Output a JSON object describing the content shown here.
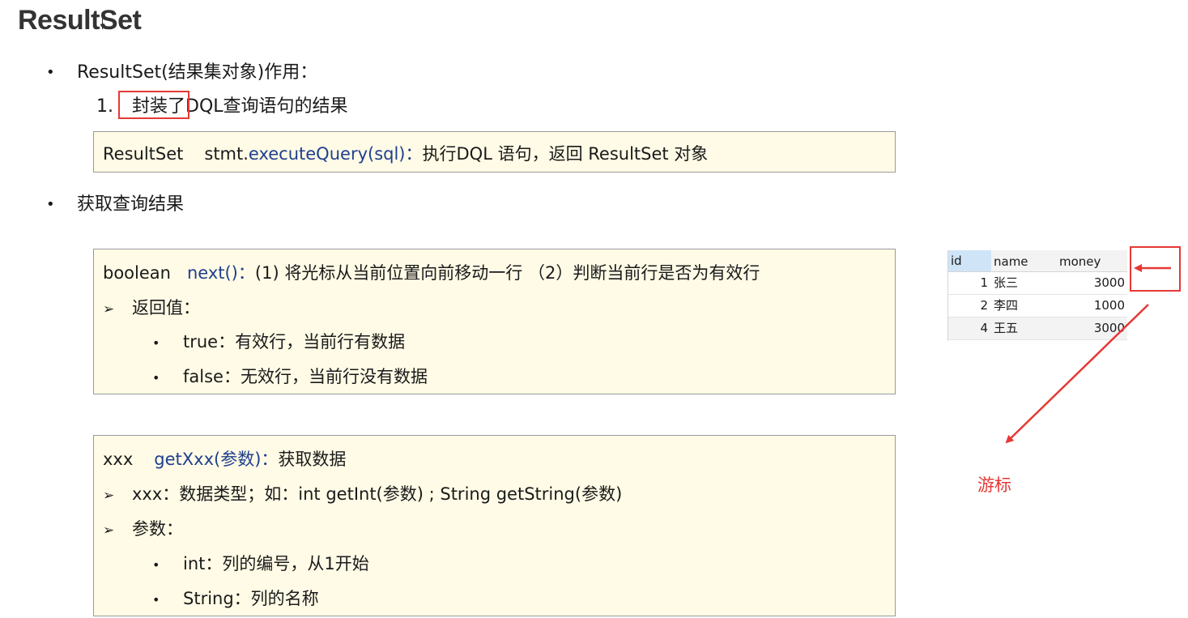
{
  "title": "ResultSet",
  "section1": {
    "bullet": "ResultSet(结果集对象)作用：",
    "numbered_prefix": "1.",
    "numbered_highlight": "封装了",
    "numbered_rest": "DQL查询语句的结果",
    "panel": {
      "type": "ResultSet",
      "obj": "stmt.",
      "method": "executeQuery(sql)：",
      "desc": "执行DQL 语句，返回 ResultSet 对象"
    }
  },
  "section2": {
    "bullet": "获取查询结果",
    "panel_next": {
      "type": "boolean",
      "method": "next()：",
      "desc": "(1) 将光标从当前位置向前移动一行 （2）判断当前行是否为有效行",
      "return_label": "返回值：",
      "items": [
        "true：有效行，当前行有数据",
        "false：无效行，当前行没有数据"
      ]
    },
    "panel_get": {
      "type": "xxx",
      "method": "getXxx(参数)：",
      "desc": "获取数据",
      "xxx_line": "xxx：数据类型；如：int getInt(参数) ; String getString(参数)",
      "param_label": "参数：",
      "items": [
        "int：列的编号，从1开始",
        "String：列的名称"
      ]
    }
  },
  "db_table": {
    "headers": [
      "id",
      "name",
      "money"
    ],
    "rows": [
      {
        "id": "1",
        "name": "张三",
        "money": "3000"
      },
      {
        "id": "2",
        "name": "李四",
        "money": "1000"
      },
      {
        "id": "4",
        "name": "王五",
        "money": "3000"
      }
    ]
  },
  "cursor_label": "游标",
  "colors": {
    "panel_bg": "#fffbe6",
    "method_blue": "#1f3f8f",
    "annotation_red": "#e53935",
    "table_header_selected": "#cfe4f7"
  }
}
